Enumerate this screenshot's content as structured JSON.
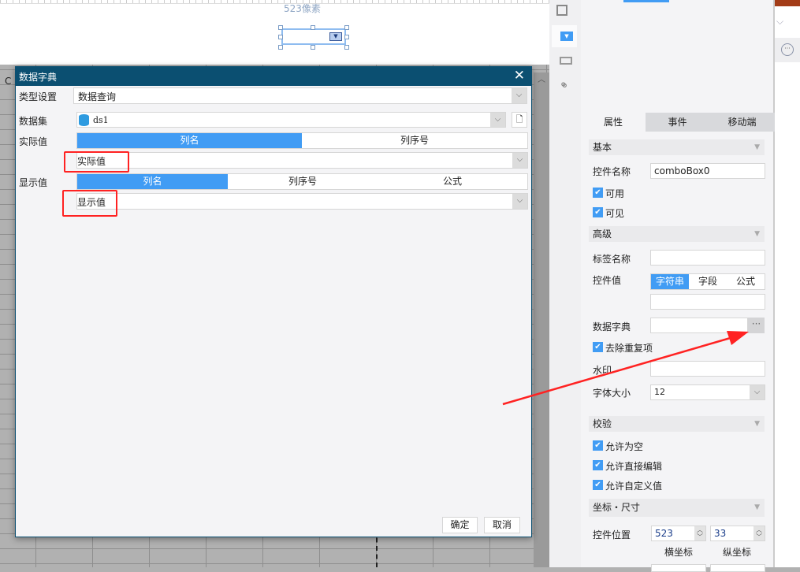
{
  "canvas": {
    "width_label": "523像素"
  },
  "sheet": {
    "column_header": "C"
  },
  "dialog": {
    "title": "数据字典",
    "type_label": "类型设置",
    "type_value": "数据查询",
    "dataset_label": "数据集",
    "dataset_value": "ds1",
    "actual_label": "实际值",
    "actual_tabs": [
      "列名",
      "列序号"
    ],
    "actual_value": "实际值",
    "display_label": "显示值",
    "display_tabs": [
      "列名",
      "列序号",
      "公式"
    ],
    "display_value": "显示值",
    "ok": "确定",
    "cancel": "取消"
  },
  "panel": {
    "tabs": [
      "属性",
      "事件",
      "移动端"
    ],
    "basic": {
      "title": "基本",
      "name_label": "控件名称",
      "name_value": "comboBox0",
      "enabled": "可用",
      "visible": "可见"
    },
    "advanced": {
      "title": "高级",
      "tag_label": "标签名称",
      "value_label": "控件值",
      "value_tabs": [
        "字符串",
        "字段",
        "公式"
      ],
      "dict_label": "数据字典",
      "dict_button": "···",
      "dedupe": "去除重复项",
      "watermark_label": "水印",
      "font_label": "字体大小",
      "font_value": "12"
    },
    "validate": {
      "title": "校验",
      "allow_empty": "允许为空",
      "allow_edit": "允许直接编辑",
      "allow_custom": "允许自定义值"
    },
    "position": {
      "title": "坐标・尺寸",
      "pos_label": "控件位置",
      "x": "523",
      "y": "33",
      "x_label": "横坐标",
      "y_label": "纵坐标"
    }
  },
  "colors": {
    "accent": "#419cf4",
    "title_bar": "#0b4f71",
    "annotation": "#ff2222"
  }
}
